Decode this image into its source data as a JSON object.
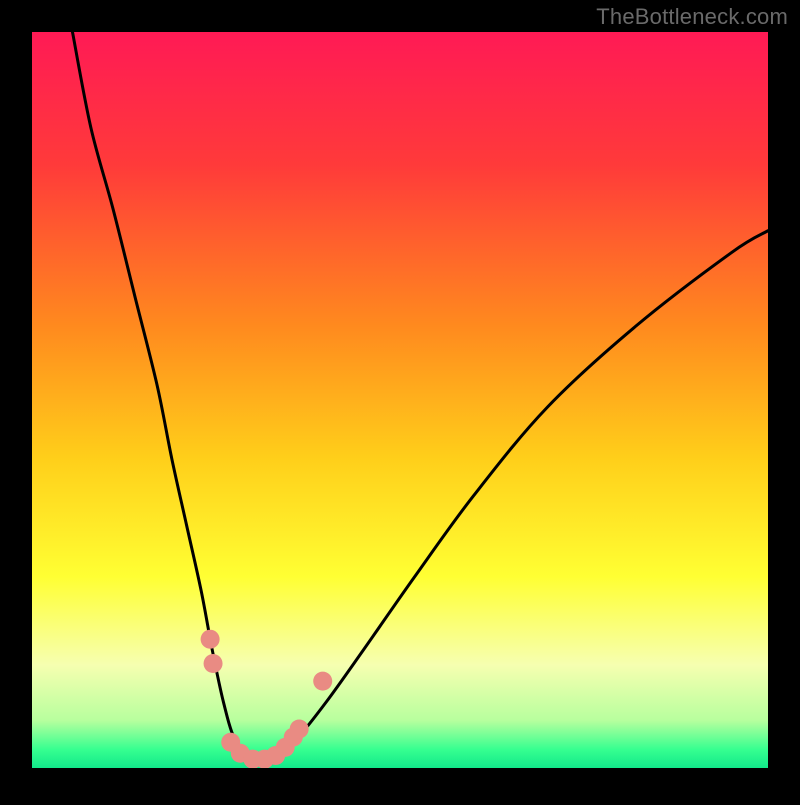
{
  "watermark": "TheBottleneck.com",
  "chart_data": {
    "type": "line",
    "title": "",
    "xlabel": "",
    "ylabel": "",
    "xlim": [
      0,
      100
    ],
    "ylim": [
      0,
      100
    ],
    "background_gradient": {
      "stops": [
        {
          "pos": 0.0,
          "color": "#ff1a55"
        },
        {
          "pos": 0.18,
          "color": "#ff3a3a"
        },
        {
          "pos": 0.4,
          "color": "#ff8a1e"
        },
        {
          "pos": 0.58,
          "color": "#ffcf1a"
        },
        {
          "pos": 0.74,
          "color": "#ffff33"
        },
        {
          "pos": 0.86,
          "color": "#f6ffb0"
        },
        {
          "pos": 0.935,
          "color": "#b8ff9e"
        },
        {
          "pos": 0.975,
          "color": "#36ff90"
        },
        {
          "pos": 1.0,
          "color": "#12e88a"
        }
      ]
    },
    "series": [
      {
        "name": "bottleneck-curve",
        "x": [
          5.5,
          8,
          11,
          14,
          17,
          19,
          21,
          23,
          24.5,
          26,
          27.5,
          29.5,
          33,
          36,
          40,
          45,
          52,
          60,
          70,
          82,
          95,
          100
        ],
        "y": [
          100,
          87,
          76,
          64,
          52,
          42,
          33,
          24,
          16,
          9,
          4,
          1.5,
          1.5,
          4,
          9,
          16,
          26,
          37,
          49,
          60,
          70,
          73
        ]
      }
    ],
    "markers": {
      "name": "highlighted-points",
      "color": "#e98b83",
      "points": [
        {
          "x": 24.2,
          "y": 17.5
        },
        {
          "x": 24.6,
          "y": 14.2
        },
        {
          "x": 27.0,
          "y": 3.5
        },
        {
          "x": 28.3,
          "y": 2.0
        },
        {
          "x": 30.0,
          "y": 1.2
        },
        {
          "x": 31.6,
          "y": 1.2
        },
        {
          "x": 33.1,
          "y": 1.7
        },
        {
          "x": 34.4,
          "y": 2.8
        },
        {
          "x": 35.5,
          "y": 4.2
        },
        {
          "x": 36.3,
          "y": 5.3
        },
        {
          "x": 39.5,
          "y": 11.8
        }
      ]
    }
  }
}
